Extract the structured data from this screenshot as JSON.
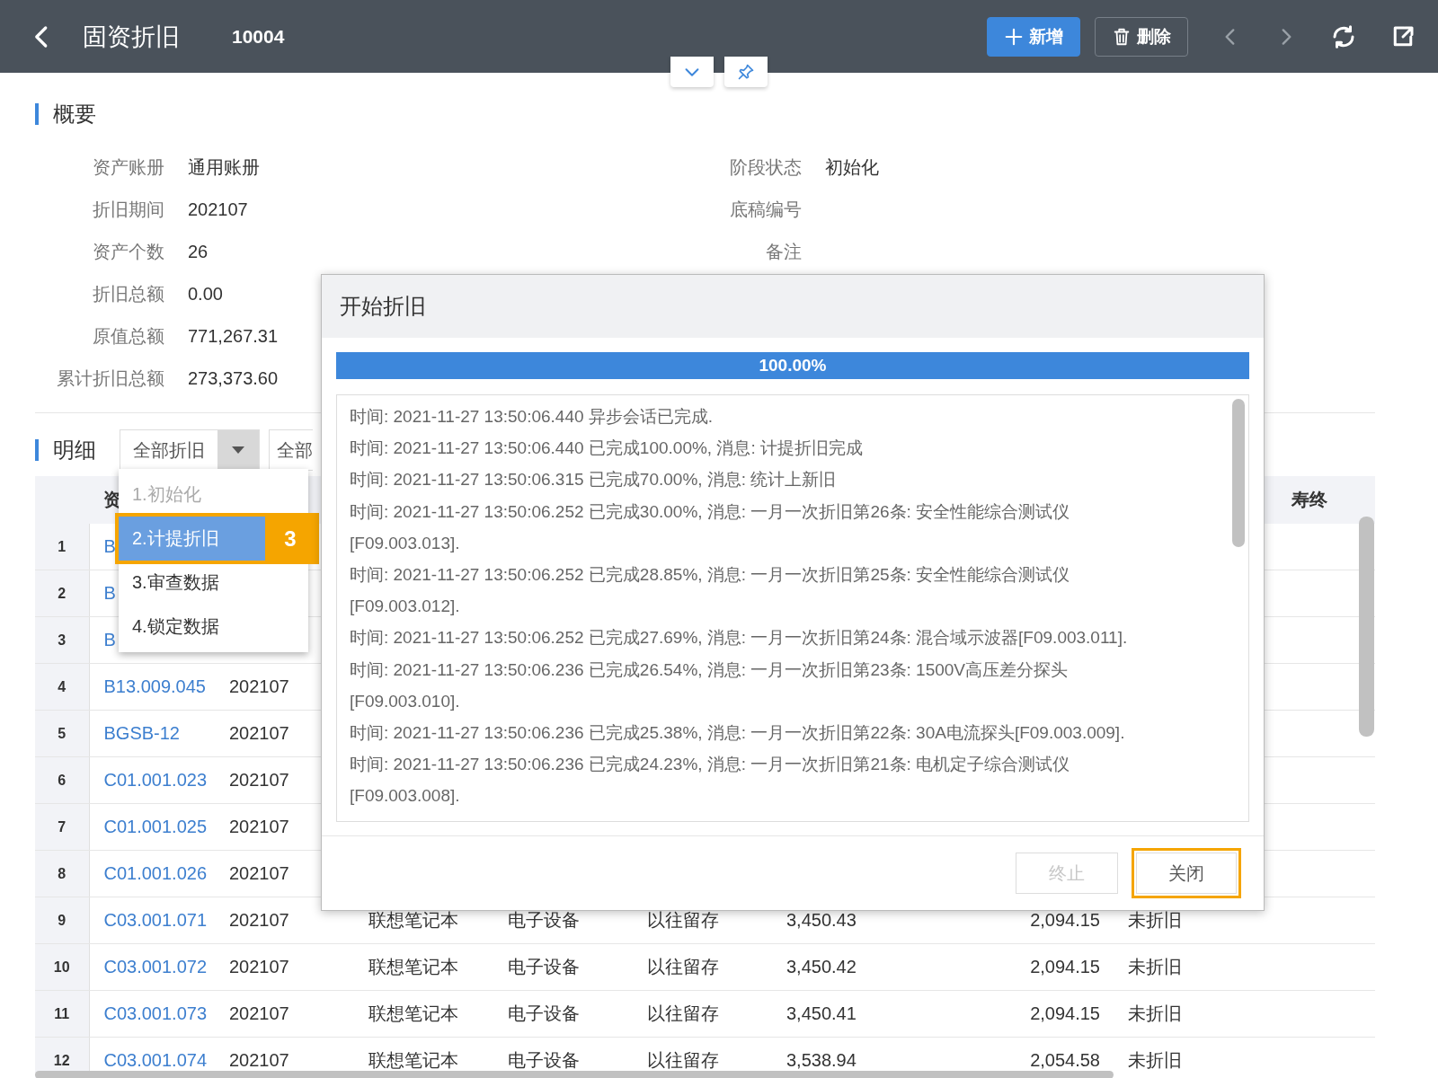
{
  "header": {
    "title": "固资折旧",
    "record": "10004",
    "buttons": [
      {
        "kind": "add",
        "label": "新增"
      },
      {
        "kind": "delete",
        "label": "删除"
      }
    ]
  },
  "overview": {
    "title": "概要",
    "left_fields": [
      {
        "label": "资产账册",
        "value": "通用账册"
      },
      {
        "label": "折旧期间",
        "value": "202107"
      },
      {
        "label": "资产个数",
        "value": "26"
      },
      {
        "label": "折旧总额",
        "value": "0.00"
      },
      {
        "label": "原值总额",
        "value": "771,267.31"
      },
      {
        "label": "累计折旧总额",
        "value": "273,373.60"
      }
    ],
    "right_fields": [
      {
        "label": "阶段状态",
        "value": "初始化"
      },
      {
        "label": "底稿编号"
      },
      {
        "label": "备注"
      }
    ]
  },
  "detail": {
    "title": "明细",
    "filter_1": {
      "value": "全部折旧"
    },
    "filter_2": {
      "value": "全部"
    },
    "dropdown": {
      "items": [
        {
          "label": "1.初始化",
          "disabled": true,
          "selected": false
        },
        {
          "label": "2.计提折旧",
          "disabled": false,
          "selected": true,
          "callout": "3"
        },
        {
          "label": "3.审查数据",
          "disabled": false,
          "selected": false
        },
        {
          "label": "4.锁定数据",
          "disabled": false,
          "selected": false
        }
      ]
    },
    "table": {
      "code_header": "资",
      "last_header": "寿终",
      "rows": [
        {
          "number": "1",
          "code": "B"
        },
        {
          "number": "2",
          "code": "B"
        },
        {
          "number": "3",
          "code": "B"
        },
        {
          "number": "4",
          "code": "B13.009.045",
          "period": "202107"
        },
        {
          "number": "5",
          "code": "BGSB-12",
          "period": "202107"
        },
        {
          "number": "6",
          "code": "C01.001.023",
          "period": "202107"
        },
        {
          "number": "7",
          "code": "C01.001.025",
          "period": "202107"
        },
        {
          "number": "8",
          "code": "C01.001.026",
          "period": "202107"
        },
        {
          "number": "9",
          "code": "C03.001.071",
          "period": "202107",
          "name": "联想笔记本",
          "category": "电子设备",
          "source": "以往留存",
          "original_value": "3,450.43",
          "accumulated": "2,094.15",
          "status": "未折旧"
        },
        {
          "number": "10",
          "code": "C03.001.072",
          "period": "202107",
          "name": "联想笔记本",
          "category": "电子设备",
          "source": "以往留存",
          "original_value": "3,450.42",
          "accumulated": "2,094.15",
          "status": "未折旧"
        },
        {
          "number": "11",
          "code": "C03.001.073",
          "period": "202107",
          "name": "联想笔记本",
          "category": "电子设备",
          "source": "以往留存",
          "original_value": "3,450.41",
          "accumulated": "2,094.15",
          "status": "未折旧"
        },
        {
          "number": "12",
          "code": "C03.001.074",
          "period": "202107",
          "name": "联想笔记本",
          "category": "电子设备",
          "source": "以往留存",
          "original_value": "3,538.94",
          "accumulated": "2,054.58",
          "status": "未折旧"
        }
      ]
    }
  },
  "dialog": {
    "title": "开始折旧",
    "progress": {
      "level": 1,
      "reading": "100.00%"
    },
    "log": [
      "时间: 2021-11-27 13:50:06.440 异步会话已完成.",
      "时间: 2021-11-27 13:50:06.440 已完成100.00%, 消息: 计提折旧完成",
      "时间: 2021-11-27 13:50:06.315 已完成70.00%, 消息: 统计上新旧",
      "时间: 2021-11-27 13:50:06.252 已完成30.00%, 消息: 一月一次折旧第26条: 安全性能综合测试仪[F09.003.013].",
      "时间: 2021-11-27 13:50:06.252 已完成28.85%, 消息: 一月一次折旧第25条: 安全性能综合测试仪[F09.003.012].",
      "时间: 2021-11-27 13:50:06.252 已完成27.69%, 消息: 一月一次折旧第24条: 混合域示波器[F09.003.011].",
      "时间: 2021-11-27 13:50:06.236 已完成26.54%, 消息: 一月一次折旧第23条: 1500V高压差分探头[F09.003.010].",
      "时间: 2021-11-27 13:50:06.236 已完成25.38%, 消息: 一月一次折旧第22条: 30A电流探头[F09.003.009].",
      "时间: 2021-11-27 13:50:06.236 已完成24.23%, 消息: 一月一次折旧第21条: 电机定子综合测试仪[F09.003.008]."
    ],
    "buttons": [
      {
        "label": "终止",
        "disabled": true,
        "highlighted": false
      },
      {
        "label": "关闭",
        "disabled": false,
        "highlighted": true
      }
    ]
  }
}
